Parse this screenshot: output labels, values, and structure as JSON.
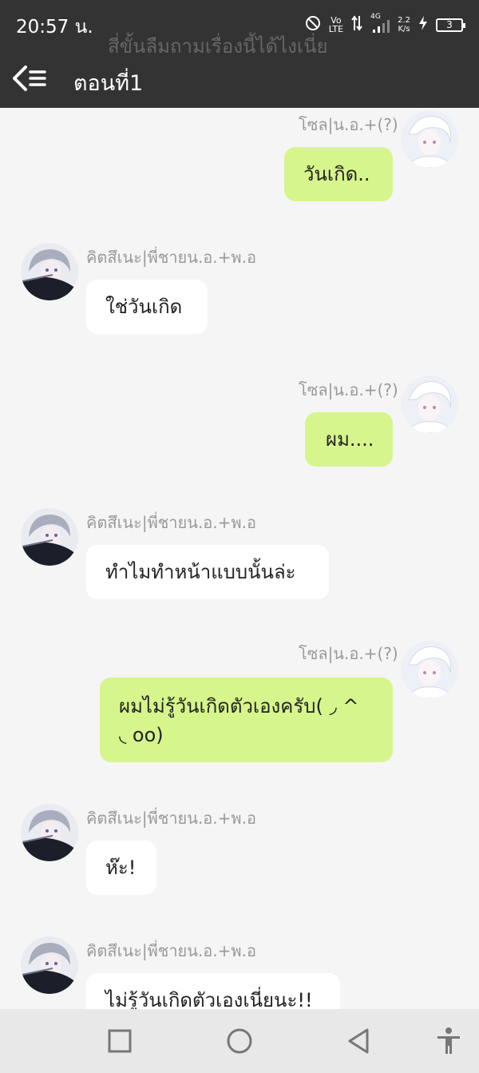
{
  "status": {
    "time": "20:57 น.",
    "network_top": "Vo",
    "network_bottom": "LTE",
    "signal_label": "4G",
    "speed_value": "2.2",
    "speed_unit": "K/s",
    "battery": "3",
    "icons": [
      "dnd-icon",
      "volte-icon",
      "data-arrows-icon",
      "signal-icon",
      "charging-icon",
      "battery-icon"
    ]
  },
  "header": {
    "ghost_line": "สี่ขั้นลืมถามเรื่องนี้ได้ไงเนี่ย",
    "title": "ตอนที่1",
    "back_icon": "back-menu-icon"
  },
  "messages": [
    {
      "side": "right",
      "name": "โซล|น.อ.+(?)",
      "text": "วันเกิด..",
      "avatar": "white-hair-avatar"
    },
    {
      "side": "left",
      "name": "คิตสึเนะ|พี่ชายน.อ.+พ.อ",
      "text": "ใช่วันเกิด",
      "avatar": "grey-hair-avatar"
    },
    {
      "side": "right",
      "name": "โซล|น.อ.+(?)",
      "text": "ผม....",
      "avatar": "white-hair-avatar"
    },
    {
      "side": "left",
      "name": "คิตสึเนะ|พี่ชายน.อ.+พ.อ",
      "text": "ทำไมทำหน้าแบบนั้นล่ะ",
      "avatar": "grey-hair-avatar"
    },
    {
      "side": "right",
      "name": "โซล|น.อ.+(?)",
      "text_line1": "ผมไม่รู้วันเกิดตัวเองครับ( ◞ ^",
      "text_line2": "◟ oo)",
      "avatar": "white-hair-avatar"
    },
    {
      "side": "left",
      "name": "คิตสึเนะ|พี่ชายน.อ.+พ.อ",
      "text": "ห๊ะ!",
      "avatar": "grey-hair-avatar"
    },
    {
      "side": "left",
      "name": "คิตสึเนะ|พี่ชายน.อ.+พ.อ",
      "text": "ไม่รู้วันเกิดตัวเองเนี่ยนะ!!",
      "avatar": "grey-hair-avatar"
    }
  ],
  "navbar": {
    "items": [
      "recent-apps-icon",
      "home-icon",
      "back-icon",
      "accessibility-icon"
    ]
  },
  "colors": {
    "header_bg": "#333333",
    "page_bg": "#f5f5f5",
    "right_bubble": "#d6f58c",
    "left_bubble": "#ffffff",
    "name_text": "#9a9a9a",
    "nav_bg": "#e8e8e8"
  }
}
